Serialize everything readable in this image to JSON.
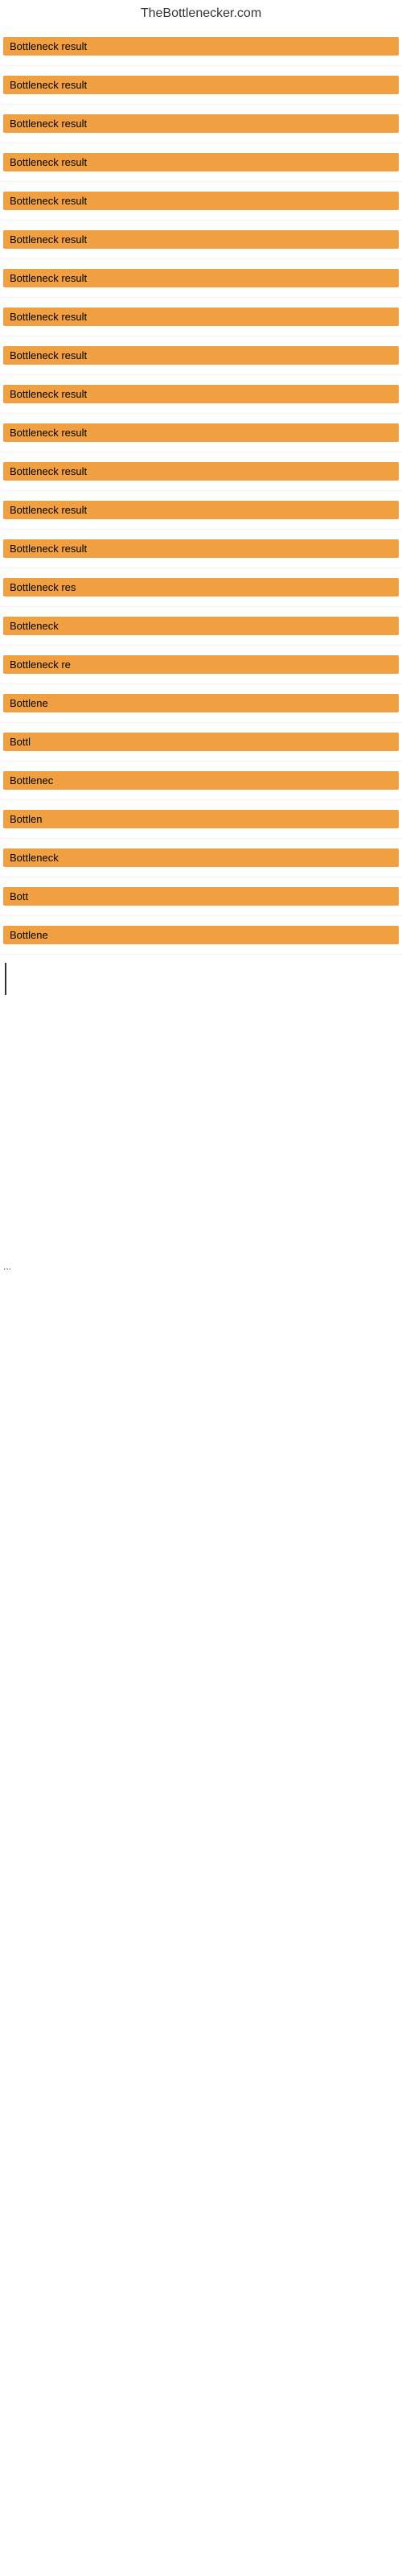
{
  "site": {
    "title": "TheBottlenecker.com"
  },
  "items": [
    {
      "id": 1,
      "label": "Bottleneck result",
      "width": "full"
    },
    {
      "id": 2,
      "label": "Bottleneck result",
      "width": "full"
    },
    {
      "id": 3,
      "label": "Bottleneck result",
      "width": "full"
    },
    {
      "id": 4,
      "label": "Bottleneck result",
      "width": "full"
    },
    {
      "id": 5,
      "label": "Bottleneck result",
      "width": "full"
    },
    {
      "id": 6,
      "label": "Bottleneck result",
      "width": "full"
    },
    {
      "id": 7,
      "label": "Bottleneck result",
      "width": "full"
    },
    {
      "id": 8,
      "label": "Bottleneck result",
      "width": "full"
    },
    {
      "id": 9,
      "label": "Bottleneck result",
      "width": "full"
    },
    {
      "id": 10,
      "label": "Bottleneck result",
      "width": "full"
    },
    {
      "id": 11,
      "label": "Bottleneck result",
      "width": "full"
    },
    {
      "id": 12,
      "label": "Bottleneck result",
      "width": "full"
    },
    {
      "id": 13,
      "label": "Bottleneck result",
      "width": "full"
    },
    {
      "id": 14,
      "label": "Bottleneck result",
      "width": "full"
    },
    {
      "id": 15,
      "label": "Bottleneck res",
      "width": "partial"
    },
    {
      "id": 16,
      "label": "Bottleneck",
      "width": "small"
    },
    {
      "id": 17,
      "label": "Bottleneck re",
      "width": "partial"
    },
    {
      "id": 18,
      "label": "Bottlene",
      "width": "small"
    },
    {
      "id": 19,
      "label": "Bottl",
      "width": "xsmall"
    },
    {
      "id": 20,
      "label": "Bottlenec",
      "width": "small"
    },
    {
      "id": 21,
      "label": "Bottlen",
      "width": "small"
    },
    {
      "id": 22,
      "label": "Bottleneck",
      "width": "small"
    },
    {
      "id": 23,
      "label": "Bott",
      "width": "xsmall"
    },
    {
      "id": 24,
      "label": "Bottlene",
      "width": "small"
    }
  ],
  "ellipsis": {
    "label": "..."
  }
}
